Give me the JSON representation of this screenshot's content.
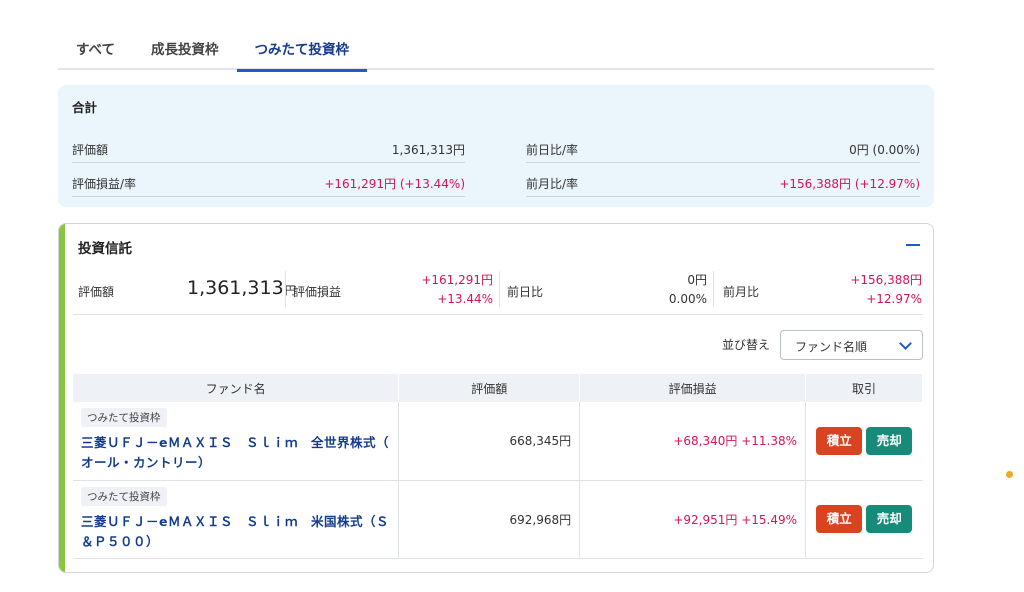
{
  "tabs": [
    "すべて",
    "成長投資枠",
    "つみたて投資枠"
  ],
  "summary": {
    "title": "合計",
    "valuation_label": "評価額",
    "valuation_value": "1,361,313円",
    "prev_day_label": "前日比/率",
    "prev_day_value": "0円 (0.00%)",
    "pl_label": "評価損益/率",
    "pl_value": "+161,291円 (+13.44%)",
    "prev_month_label": "前月比/率",
    "prev_month_value": "+156,388円 (+12.97%)"
  },
  "card": {
    "title": "投資信託",
    "valuation_label": "評価額",
    "valuation_value": "1,361,313",
    "valuation_unit": "円",
    "pl_label": "評価損益",
    "pl_amount": "+161,291円",
    "pl_rate": "+13.44%",
    "prev_day_label": "前日比",
    "prev_day_amount": "0円",
    "prev_day_rate": "0.00%",
    "prev_month_label": "前月比",
    "prev_month_amount": "+156,388円",
    "prev_month_rate": "+12.97%",
    "sort_label": "並び替え",
    "sort_value": "ファンド名順",
    "columns": [
      "ファンド名",
      "評価額",
      "評価損益",
      "取引"
    ],
    "funds": [
      {
        "tag": "つみたて投資枠",
        "name_line1": "三菱ＵＦＪ－eＭＡＸＩＳ　Ｓｌｉｍ　全世界株式（",
        "name_line2": "オール・カントリー）",
        "valuation": "668,345円",
        "pl": "+68,340円  +11.38%",
        "buy_label": "積立",
        "sell_label": "売却"
      },
      {
        "tag": "つみたて投資枠",
        "name_line1": "三菱ＵＦＪ－eＭＡＸＩＳ　Ｓｌｉｍ　米国株式（Ｓ",
        "name_line2": "＆Ｐ５００）",
        "valuation": "692,968円",
        "pl": "+92,951円  +15.49%",
        "buy_label": "積立",
        "sell_label": "売却"
      }
    ]
  },
  "colors": {
    "accent": "#1f5bc6",
    "positive": "#d4145a",
    "buy_button": "#d9431f",
    "sell_button": "#178b7a",
    "card_bar": "#8bc53f"
  }
}
